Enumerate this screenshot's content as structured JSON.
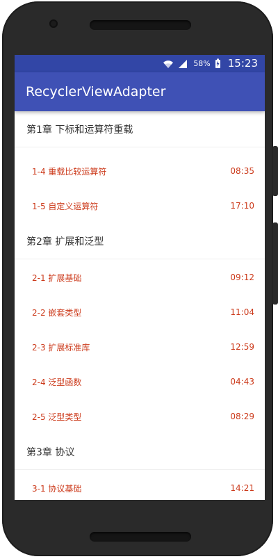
{
  "status_bar": {
    "battery": "58%",
    "time": "15:23"
  },
  "app_bar": {
    "title": "RecyclerViewAdapter"
  },
  "chapters": [
    {
      "title": "第1章 下标和运算符重载",
      "lessons": [
        {
          "title": "1-4 重载比较运算符",
          "duration": "08:35"
        },
        {
          "title": "1-5 自定义运算符",
          "duration": "17:10"
        }
      ]
    },
    {
      "title": "第2章 扩展和泛型",
      "lessons": [
        {
          "title": "2-1 扩展基础",
          "duration": "09:12"
        },
        {
          "title": "2-2 嵌套类型",
          "duration": "11:04"
        },
        {
          "title": "2-3 扩展标准库",
          "duration": "12:59"
        },
        {
          "title": "2-4 泛型函数",
          "duration": "04:43"
        },
        {
          "title": "2-5 泛型类型",
          "duration": "08:29"
        }
      ]
    },
    {
      "title": "第3章 协议",
      "lessons": [
        {
          "title": "3-1 协议基础",
          "duration": "14:21"
        }
      ]
    }
  ],
  "theme": {
    "primary": "#3f51b5",
    "primary_dark": "#3246a6",
    "accent_text": "#cc3a1b"
  }
}
